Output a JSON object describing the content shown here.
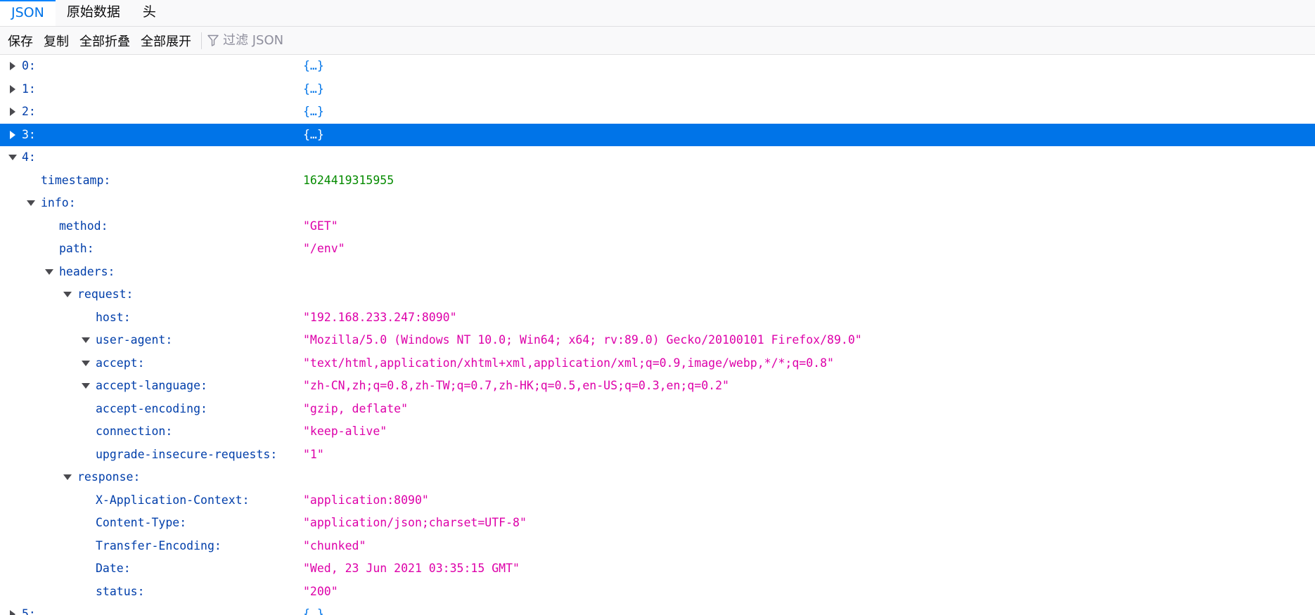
{
  "tabs": [
    {
      "label": "JSON",
      "active": true
    },
    {
      "label": "原始数据",
      "active": false
    },
    {
      "label": "头",
      "active": false
    }
  ],
  "toolbar": {
    "save": "保存",
    "copy": "复制",
    "collapse_all": "全部折叠",
    "expand_all": "全部展开",
    "filter_placeholder": "过滤 JSON",
    "filter_icon": "funnel-icon"
  },
  "colors": {
    "accent": "#0074e8",
    "key": "#003eaa",
    "string": "#dd00a9",
    "number": "#058b00",
    "selected_row": "#0074e8"
  },
  "tree": {
    "r0": {
      "key": "0:",
      "value": "{…}"
    },
    "r1": {
      "key": "1:",
      "value": "{…}"
    },
    "r2": {
      "key": "2:",
      "value": "{…}"
    },
    "r3": {
      "key": "3:",
      "value": "{…}"
    },
    "r4": {
      "key": "4:"
    },
    "timestamp": {
      "key": "timestamp:",
      "value": "1624419315955"
    },
    "info": {
      "key": "info:"
    },
    "method": {
      "key": "method:",
      "value": "\"GET\""
    },
    "path": {
      "key": "path:",
      "value": "\"/env\""
    },
    "headers": {
      "key": "headers:"
    },
    "request": {
      "key": "request:"
    },
    "host": {
      "key": "host:",
      "value": "\"192.168.233.247:8090\""
    },
    "user_agent": {
      "key": "user-agent:",
      "value": "\"Mozilla/5.0 (Windows NT 10.0; Win64; x64; rv:89.0) Gecko/20100101 Firefox/89.0\""
    },
    "accept": {
      "key": "accept:",
      "value": "\"text/html,application/xhtml+xml,application/xml;q=0.9,image/webp,*/*;q=0.8\""
    },
    "accept_language": {
      "key": "accept-language:",
      "value": "\"zh-CN,zh;q=0.8,zh-TW;q=0.7,zh-HK;q=0.5,en-US;q=0.3,en;q=0.2\""
    },
    "accept_encoding": {
      "key": "accept-encoding:",
      "value": "\"gzip, deflate\""
    },
    "connection": {
      "key": "connection:",
      "value": "\"keep-alive\""
    },
    "upgrade_insecure": {
      "key": "upgrade-insecure-requests:",
      "value": "\"1\""
    },
    "response": {
      "key": "response:"
    },
    "x_app_context": {
      "key": "X-Application-Context:",
      "value": "\"application:8090\""
    },
    "content_type": {
      "key": "Content-Type:",
      "value": "\"application/json;charset=UTF-8\""
    },
    "transfer_encoding": {
      "key": "Transfer-Encoding:",
      "value": "\"chunked\""
    },
    "date": {
      "key": "Date:",
      "value": "\"Wed, 23 Jun 2021 03:35:15 GMT\""
    },
    "status": {
      "key": "status:",
      "value": "\"200\""
    },
    "r5": {
      "key": "5:",
      "value": "{…}"
    }
  }
}
